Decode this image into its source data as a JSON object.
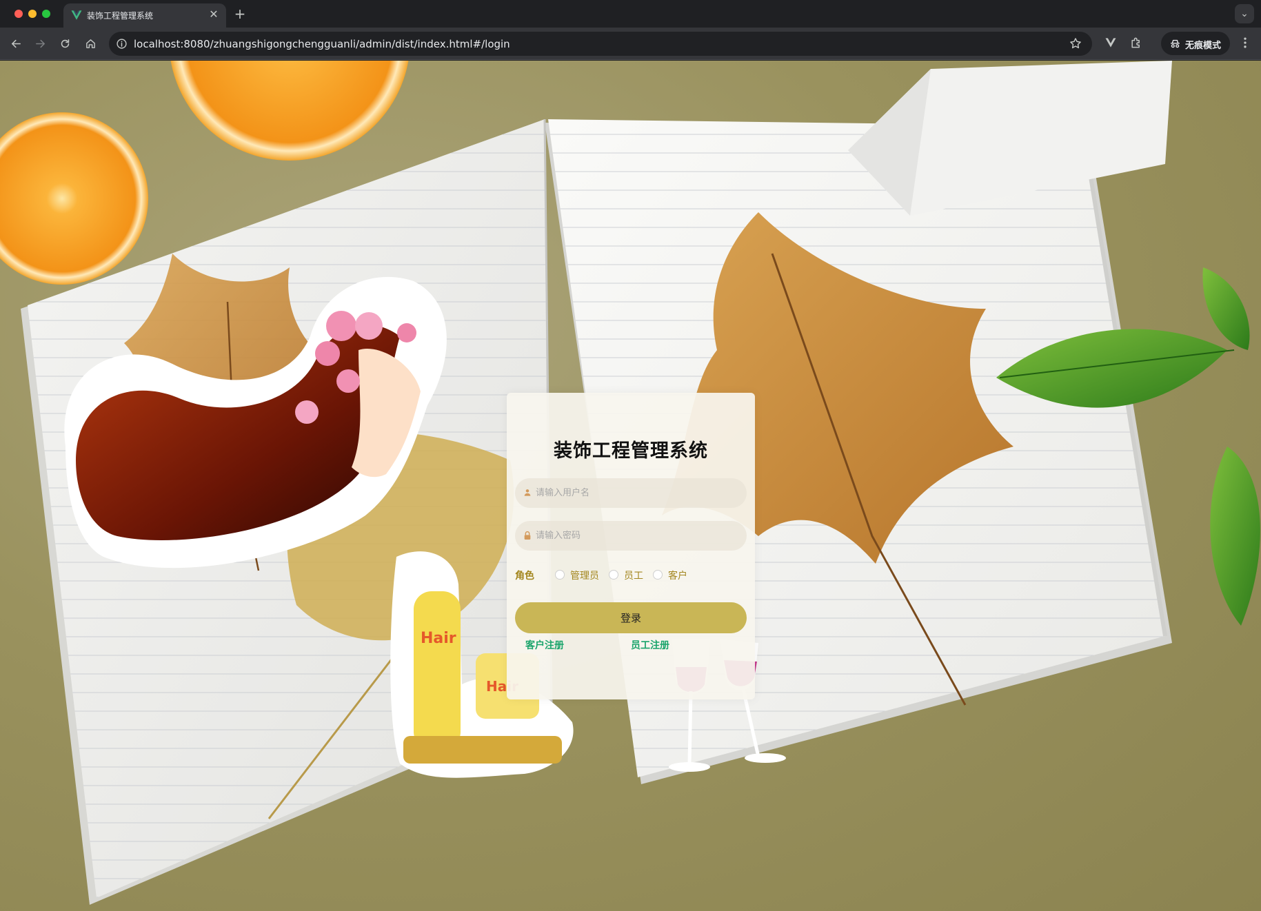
{
  "browser": {
    "tab_title": "装饰工程管理系统",
    "url": "localhost:8080/zhuangshigongchengguanli/admin/dist/index.html#/login",
    "incognito_label": "无痕模式",
    "icons": {
      "back": "arrow-left-icon",
      "forward": "arrow-right-icon",
      "reload": "reload-icon",
      "home": "home-icon",
      "site_info": "info-icon",
      "bookmark": "star-icon",
      "extension_vue": "vue-devtools-icon",
      "extensions": "puzzle-icon",
      "menu": "kebab-icon"
    }
  },
  "login": {
    "title": "装饰工程管理系统",
    "username_placeholder": "请输入用户名",
    "password_placeholder": "请输入密码",
    "role_label": "角色",
    "roles": [
      "管理员",
      "员工",
      "客户"
    ],
    "login_button": "登录",
    "register_customer": "客户注册",
    "register_staff": "员工注册"
  },
  "colors": {
    "accent": "#c9b656",
    "role_text": "#a3861e",
    "link": "#1aa46b",
    "card_bg": "#f7f5ee"
  }
}
